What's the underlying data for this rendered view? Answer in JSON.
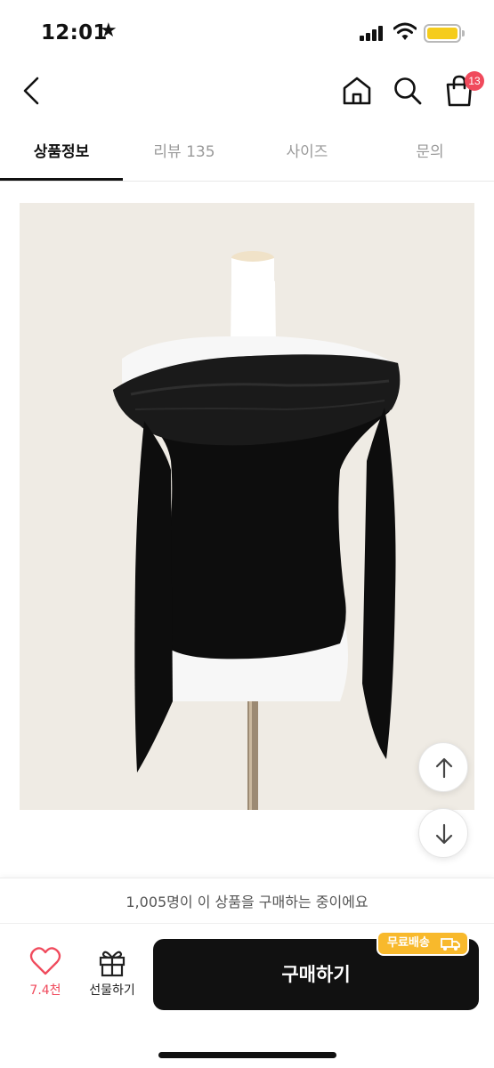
{
  "status_bar": {
    "time": "12:01"
  },
  "header": {
    "cart_count": "13"
  },
  "tabs": [
    {
      "label": "상품정보",
      "active": true
    },
    {
      "label": "리뷰 135",
      "active": false
    },
    {
      "label": "사이즈",
      "active": false
    },
    {
      "label": "문의",
      "active": false
    }
  ],
  "product_image": {
    "description_icon": "product-photo-black-off-shoulder-top"
  },
  "bottom": {
    "buying_now": "1,005명이 이 상품을 구매하는 중이에요",
    "like_count": "7.4천",
    "gift_label": "선물하기",
    "buy_label": "구매하기",
    "free_shipping_badge": "무료배송"
  },
  "colors": {
    "accent": "#f04a5c",
    "badge": "#f8b92c",
    "buy_button": "#111111"
  }
}
